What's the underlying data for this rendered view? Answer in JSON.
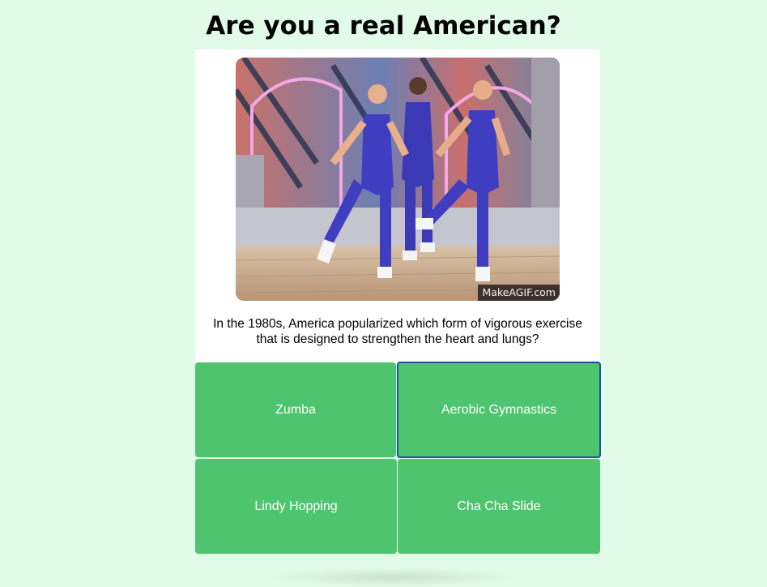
{
  "page": {
    "title": "Are you a real American?",
    "background_color": "#e2fbe8"
  },
  "quiz": {
    "image": {
      "description_icon": "aerobics-dancers-gif",
      "watermark": "MakeAGIF.com"
    },
    "question": "In the 1980s, America popularized which form of vigorous exercise that is designed to strengthen the heart and lungs?",
    "answer_color": "#4ec46e",
    "selected_border_color": "#1c4fa0",
    "answers": [
      {
        "label": "Zumba",
        "selected": false
      },
      {
        "label": "Aerobic Gymnastics",
        "selected": true
      },
      {
        "label": "Lindy Hopping",
        "selected": false
      },
      {
        "label": "Cha Cha Slide",
        "selected": false
      }
    ]
  }
}
